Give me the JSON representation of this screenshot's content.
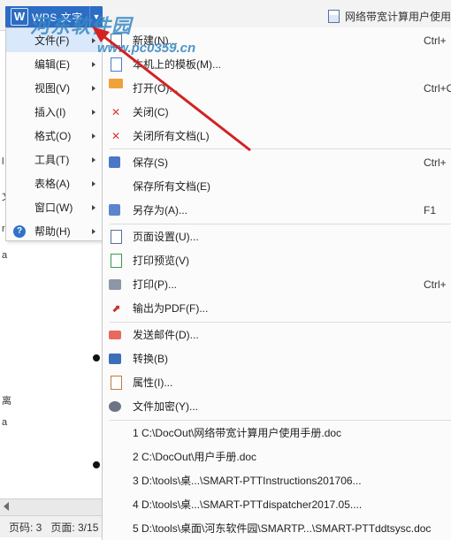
{
  "titlebar": {
    "app_title": "WPS 文字",
    "window_label": "网络带宽计算用户使用"
  },
  "watermark": {
    "main": "河东软件园",
    "sub": "www.pc0359.cn"
  },
  "left_menu": [
    {
      "label": "文件(F)",
      "active": true
    },
    {
      "label": "编辑(E)"
    },
    {
      "label": "视图(V)"
    },
    {
      "label": "插入(I)"
    },
    {
      "label": "格式(O)"
    },
    {
      "label": "工具(T)"
    },
    {
      "label": "表格(A)"
    },
    {
      "label": "窗口(W)"
    },
    {
      "label": "帮助(H)",
      "icon": "help-icon"
    }
  ],
  "file_menu": {
    "items": [
      {
        "label": "新建(N)...",
        "shortcut": "Ctrl+",
        "icon": "new-doc-icon"
      },
      {
        "label": "本机上的模板(M)...",
        "shortcut": "",
        "icon": "template-icon"
      },
      {
        "label": "打开(O)...",
        "shortcut": "Ctrl+O",
        "icon": "open-folder-icon"
      },
      {
        "label": "关闭(C)",
        "shortcut": "",
        "icon": "close-doc-icon"
      },
      {
        "label": "关闭所有文档(L)",
        "shortcut": "",
        "icon": "close-all-icon"
      },
      {
        "label": "保存(S)",
        "shortcut": "Ctrl+",
        "icon": "save-icon"
      },
      {
        "label": "保存所有文档(E)",
        "shortcut": "",
        "icon": ""
      },
      {
        "label": "另存为(A)...",
        "shortcut": "F1",
        "icon": "save-as-icon"
      },
      {
        "label": "页面设置(U)...",
        "shortcut": "",
        "icon": "page-setup-icon"
      },
      {
        "label": "打印预览(V)",
        "shortcut": "",
        "icon": "print-preview-icon"
      },
      {
        "label": "打印(P)...",
        "shortcut": "Ctrl+",
        "icon": "print-icon"
      },
      {
        "label": "输出为PDF(F)...",
        "shortcut": "",
        "icon": "pdf-icon"
      },
      {
        "label": "发送邮件(D)...",
        "shortcut": "",
        "icon": "mail-icon"
      },
      {
        "label": "转换(B)",
        "shortcut": "",
        "icon": "convert-icon"
      },
      {
        "label": "属性(I)...",
        "shortcut": "",
        "icon": "properties-icon"
      },
      {
        "label": "文件加密(Y)...",
        "shortcut": "",
        "icon": "encrypt-icon"
      }
    ],
    "recent": [
      "1 C:\\DocOut\\网络带宽计算用户使用手册.doc",
      "2 C:\\DocOut\\用户手册.doc",
      "3 D:\\tools\\桌...\\SMART-PTTInstructions201706...",
      "4 D:\\tools\\桌...\\SMART-PTTdispatcher2017.05....",
      "5 D:\\tools\\桌面\\河东软件园\\SMARTP...\\SMART-PTTddtsysc.doc"
    ]
  },
  "doc_glyphs": [
    "l",
    "文",
    "r",
    "a",
    "离",
    "a"
  ],
  "statusbar": {
    "page_code": "页码: 3",
    "page_count": "页面: 3/15"
  }
}
